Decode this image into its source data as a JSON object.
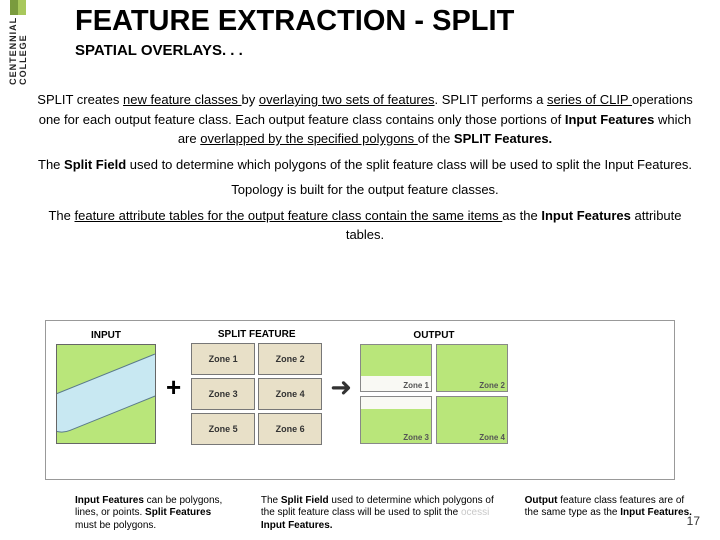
{
  "logo": {
    "text": "CENTENNIAL COLLEGE"
  },
  "title": "FEATURE EXTRACTION - SPLIT",
  "subtitle": "SPATIAL OVERLAYS. . .",
  "para1": {
    "pre": "SPLIT creates ",
    "u1": "new feature classes ",
    "mid1": "by ",
    "u2": "overlaying two sets of features",
    "mid2": ". SPLIT performs a ",
    "u3": "series of CLIP ",
    "mid3": "operations one for each output feature class. Each output feature class contains only those portions of ",
    "b1": "Input Features",
    "mid4": " which are ",
    "u4": "overlapped by the specified polygons ",
    "mid5": "of the ",
    "b2": "SPLIT Features."
  },
  "para2": {
    "pre": "The ",
    "b": "Split Field",
    "post": " used to determine which polygons of the split feature class will be used to split the Input Features."
  },
  "para3": "Topology is built for the output feature classes.",
  "para4": {
    "pre": "The ",
    "u": "feature attribute tables for the output feature class contain the same items ",
    "post": "as the ",
    "b": "Input Features",
    "post2": " attribute tables."
  },
  "diagram": {
    "inputLabel": "INPUT",
    "splitLabel": "SPLIT FEATURE",
    "outputLabel": "OUTPUT",
    "zones": [
      "Zone 1",
      "Zone 2",
      "Zone 3",
      "Zone 4",
      "Zone 5",
      "Zone 6"
    ],
    "outZones": [
      "Zone 1",
      "Zone 2",
      "Zone 3",
      "Zone 4"
    ]
  },
  "captions": {
    "c1a": "Input Features",
    "c1b": " can be polygons, lines, or points. ",
    "c1c": "Split Features",
    "c1d": " must be polygons.",
    "c2a": "The ",
    "c2b": "Split Field",
    "c2c": " used to determine which polygons of the split feature class will be used to split the ",
    "c2d": "Input Features.",
    "c3a": "Output",
    "c3b": " feature class features are of the same type as the ",
    "c3c": "Input Features."
  },
  "faded": "ocessi",
  "pageNumber": "17"
}
